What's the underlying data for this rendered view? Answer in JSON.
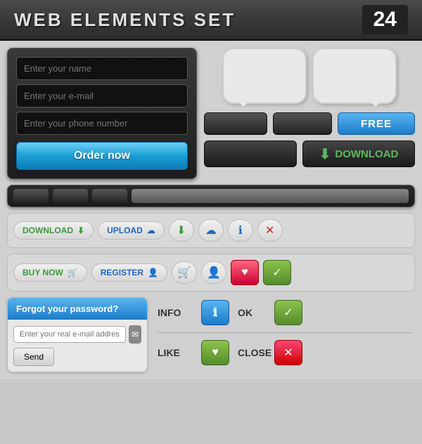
{
  "header": {
    "title": "WEB ELEMENTS SET",
    "number": "24"
  },
  "form": {
    "name_placeholder": "Enter your name",
    "email_placeholder": "Enter your e-mail",
    "phone_placeholder": "Enter your phone number",
    "order_btn": "Order now"
  },
  "buttons": {
    "free_label": "FREE",
    "download_label": "DOWNLOAD",
    "download_action": "DOWNLOAD",
    "upload_action": "UPLOAD",
    "buy_now": "BUY NOW",
    "register": "REGISTER",
    "send": "Send",
    "info": "INFO",
    "ok": "OK",
    "like": "LIKE",
    "close": "CLOSE"
  },
  "password": {
    "header": "Forgot your password?",
    "placeholder": "Enter your real e-mail address"
  }
}
